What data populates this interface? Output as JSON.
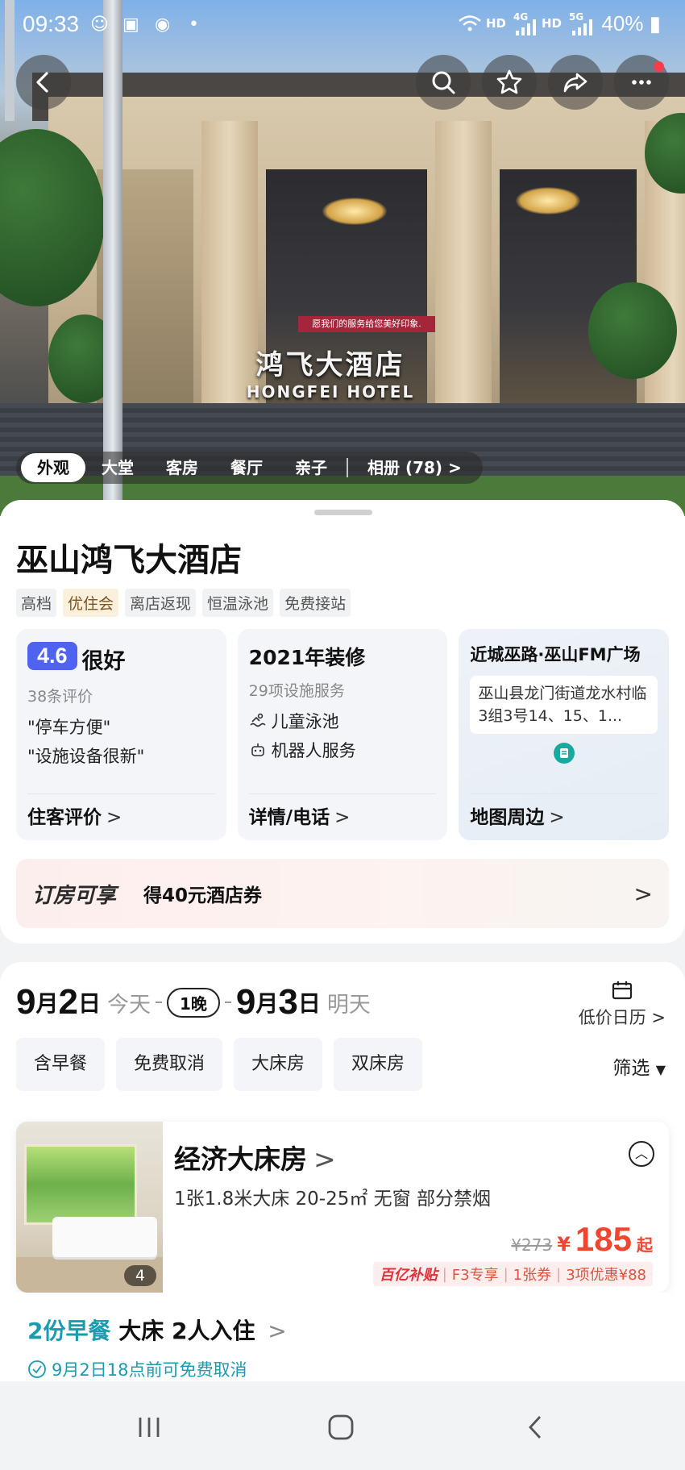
{
  "status_bar": {
    "time": "09:33",
    "dot": "•",
    "net1": "HD",
    "net2": "4G",
    "net3": "HD",
    "net4": "5G",
    "battery": "40%"
  },
  "hero": {
    "sign_cn": "鸿飞大酒店",
    "sign_en": "HONGFEI HOTEL",
    "banner": "愿我们的服务给您美好印象."
  },
  "photo_tabs": {
    "items": [
      "外观",
      "大堂",
      "客房",
      "餐厅",
      "亲子"
    ],
    "album": "相册 (78)",
    "album_chevron": ">"
  },
  "hotel": {
    "name": "巫山鸿飞大酒店",
    "tags": [
      "高档",
      "优住会",
      "离店返现",
      "恒温泳池",
      "免费接站"
    ]
  },
  "review_card": {
    "score": "4.6",
    "word": "很好",
    "count": "38条评价",
    "quotes": [
      "\"停车方便\"",
      "\"设施设备很新\""
    ],
    "link": "住客评价",
    "chevron": ">"
  },
  "facility_card": {
    "title": "2021年装修",
    "count": "29项设施服务",
    "items": [
      "儿童泳池",
      "机器人服务"
    ],
    "link": "详情/电话",
    "chevron": ">"
  },
  "location_card": {
    "title": "近城巫路·巫山FM广场",
    "address": "巫山县龙门街道龙水村临3组3号14、15、1...",
    "link": "地图周边",
    "chevron": ">"
  },
  "promo": {
    "brand": "订房可享",
    "text": "得40元酒店券",
    "chevron": ">"
  },
  "dates": {
    "checkin_month": "9",
    "checkin_day": "2",
    "checkin_label": "今天",
    "nights": "1晚",
    "checkout_month": "9",
    "checkout_day": "3",
    "checkout_label": "明天",
    "month_char": "月",
    "day_char": "日",
    "calendar_label": "低价日历",
    "calendar_chevron": ">"
  },
  "filters": {
    "chips": [
      "含早餐",
      "免费取消",
      "大床房",
      "双床房"
    ],
    "filter_label": "筛选"
  },
  "room": {
    "title": "经济大床房",
    "chevron": ">",
    "spec": "1张1.8米大床  20-25㎡  无窗  部分禁烟",
    "photo_count": "4",
    "original_price": "¥273",
    "yen": "¥",
    "price": "185",
    "from": "起",
    "deal_brand": "百亿补贴",
    "deals": [
      "F3专享",
      "1张券",
      "3项优惠¥88"
    ]
  },
  "rate_plan": {
    "breakfast": "2份早餐",
    "bed": "大床",
    "guests": "2人入住",
    "chevron": ">",
    "cancel": "9月2日18点前可免费取消"
  },
  "colors": {
    "score_bg": "#4f63f0",
    "price": "#f0462f",
    "teal": "#1a9bb0"
  }
}
